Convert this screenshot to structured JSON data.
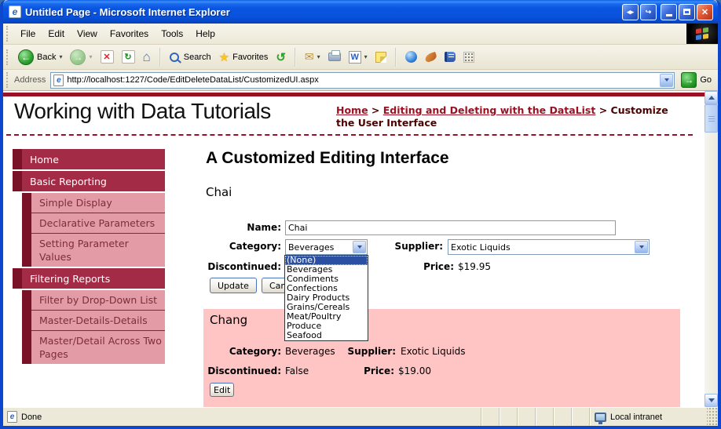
{
  "window": {
    "title": "Untitled Page - Microsoft Internet Explorer",
    "icon_letter": "e",
    "buttons": {
      "resize": "◂▸",
      "detach": "↪",
      "close": "✕"
    }
  },
  "menu": {
    "items": [
      "File",
      "Edit",
      "View",
      "Favorites",
      "Tools",
      "Help"
    ]
  },
  "toolbar": {
    "back_label": "Back",
    "search_label": "Search",
    "favorites_label": "Favorites",
    "icons": {
      "back": "←",
      "forward": "→",
      "stop": "✕",
      "refresh": "↻",
      "home": "⌂",
      "history": "↺",
      "mail": "✉",
      "word": "W",
      "caret": "▾"
    }
  },
  "address": {
    "label": "Address",
    "url": "http://localhost:1227/Code/EditDeleteDataList/CustomizedUI.aspx",
    "go_label": "Go",
    "go_icon": "→",
    "icon_letter": "e"
  },
  "statusbar": {
    "left": "Done",
    "right": "Local intranet",
    "icon_letter": "e"
  },
  "page": {
    "site_title": "Working with Data Tutorials",
    "breadcrumb": {
      "home": "Home",
      "sep1": " > ",
      "section": "Editing and Deleting with the DataList",
      "sep2": " > ",
      "current": "Customize the User Interface"
    },
    "sidebar": {
      "items": [
        {
          "label": "Home"
        },
        {
          "label": "Basic Reporting"
        },
        {
          "label": "Simple Display"
        },
        {
          "label": "Declarative Parameters"
        },
        {
          "label": "Setting Parameter Values"
        },
        {
          "label": "Filtering Reports"
        },
        {
          "label": "Filter by Drop-Down List"
        },
        {
          "label": "Master-Details-Details"
        },
        {
          "label": "Master/Detail Across Two Pages"
        }
      ]
    },
    "heading": "A Customized Editing Interface",
    "edit_item": {
      "title": "Chai",
      "name_label": "Name:",
      "name_value": "Chai",
      "category_label": "Category:",
      "category_value": "Beverages",
      "supplier_label": "Supplier:",
      "supplier_value": "Exotic Liquids",
      "discontinued_label": "Discontinued:",
      "price_label": "Price:",
      "price_value": "$19.95",
      "update_label": "Update",
      "cancel_label": "Cancel",
      "category_options": [
        "(None)",
        "Beverages",
        "Condiments",
        "Confections",
        "Dairy Products",
        "Grains/Cereals",
        "Meat/Poultry",
        "Produce",
        "Seafood"
      ],
      "highlighted_option": "(None)"
    },
    "display_item": {
      "title": "Chang",
      "category_label": "Category:",
      "category_value": "Beverages",
      "supplier_label": "Supplier:",
      "supplier_value": "Exotic Liquids",
      "discontinued_label": "Discontinued:",
      "discontinued_value": "False",
      "price_label": "Price:",
      "price_value": "$19.00",
      "edit_label": "Edit"
    }
  },
  "colors": {
    "sidebar_accent_dark": "#7A1227",
    "sidebar_item": "#A42B45",
    "sidebar_subitem": "#E39CA6",
    "panel_pink": "#FFC4C4",
    "maroon_rule": "#991122",
    "selection_blue": "#2B4FA2",
    "titlebar_blue": "#0852DC"
  }
}
